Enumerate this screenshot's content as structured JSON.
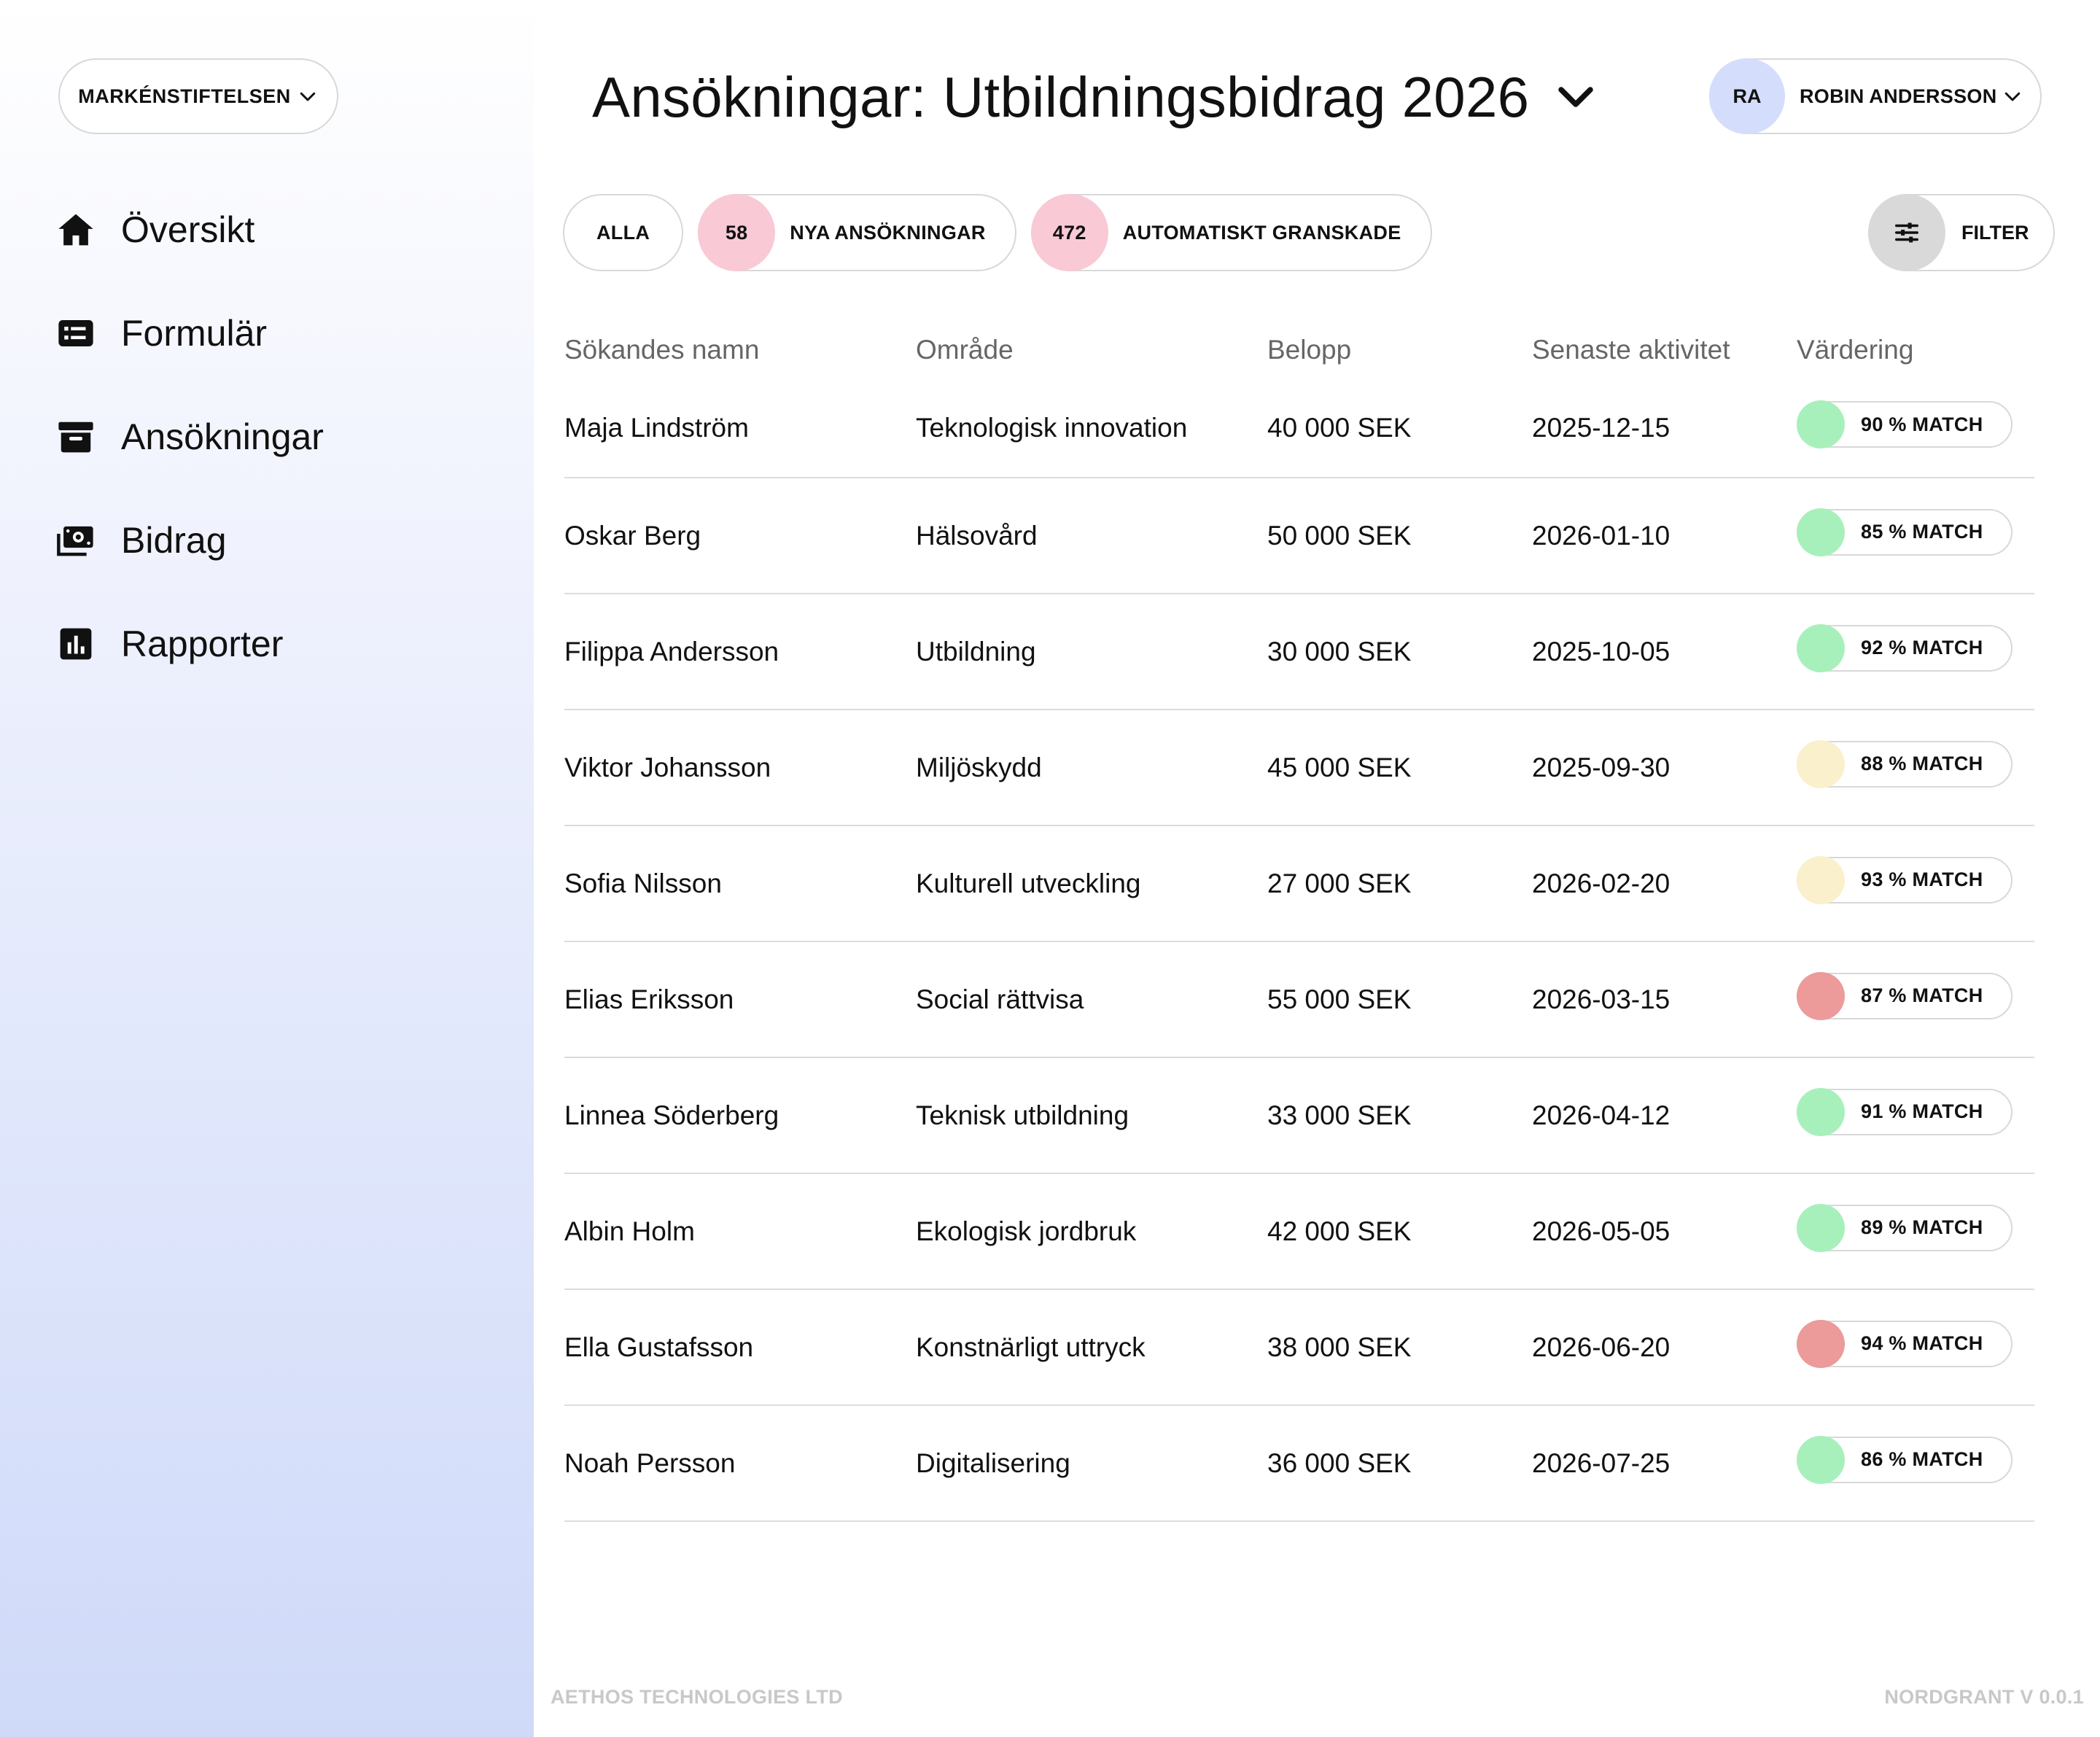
{
  "org": {
    "name": "MARKÉNSTIFTELSEN"
  },
  "nav": [
    {
      "label": "Översikt",
      "icon": "home-icon"
    },
    {
      "label": "Formulär",
      "icon": "form-list-icon"
    },
    {
      "label": "Ansökningar",
      "icon": "archive-icon"
    },
    {
      "label": "Bidrag",
      "icon": "money-icon"
    },
    {
      "label": "Rapporter",
      "icon": "report-chart-icon"
    }
  ],
  "header": {
    "title": "Ansökningar: Utbildningsbidrag 2026"
  },
  "user": {
    "initials": "RA",
    "name": "ROBIN ANDERSSON"
  },
  "tabs": {
    "all": "ALLA",
    "new": {
      "count": "58",
      "label": "NYA ANSÖKNINGAR"
    },
    "auto": {
      "count": "472",
      "label": "AUTOMATISKT GRANSKADE"
    }
  },
  "filter": {
    "label": "FILTER",
    "icon": "sliders-icon"
  },
  "table": {
    "columns": [
      "Sökandes namn",
      "Område",
      "Belopp",
      "Senaste aktivitet",
      "Värdering"
    ],
    "rows": [
      {
        "name": "Maja Lindström",
        "area": "Teknologisk innovation",
        "amount": "40 000 SEK",
        "date": "2025-12-15",
        "match": "90 % MATCH",
        "status_color": "#a8f0bb"
      },
      {
        "name": "Oskar Berg",
        "area": "Hälsovård",
        "amount": "50 000 SEK",
        "date": "2026-01-10",
        "match": "85 % MATCH",
        "status_color": "#a8f0bb"
      },
      {
        "name": "Filippa Andersson",
        "area": "Utbildning",
        "amount": "30 000 SEK",
        "date": "2025-10-05",
        "match": "92 % MATCH",
        "status_color": "#a8f0bb"
      },
      {
        "name": "Viktor Johansson",
        "area": "Miljöskydd",
        "amount": "45 000 SEK",
        "date": "2025-09-30",
        "match": "88 % MATCH",
        "status_color": "#faf0cc"
      },
      {
        "name": "Sofia Nilsson",
        "area": "Kulturell utveckling",
        "amount": "27 000 SEK",
        "date": "2026-02-20",
        "match": "93 % MATCH",
        "status_color": "#faf0cc"
      },
      {
        "name": "Elias Eriksson",
        "area": "Social rättvisa",
        "amount": "55 000 SEK",
        "date": "2026-03-15",
        "match": "87 % MATCH",
        "status_color": "#ec9a9a"
      },
      {
        "name": "Linnea Söderberg",
        "area": "Teknisk utbildning",
        "amount": "33 000 SEK",
        "date": "2026-04-12",
        "match": "91 % MATCH",
        "status_color": "#a8f0bb"
      },
      {
        "name": "Albin Holm",
        "area": "Ekologisk jordbruk",
        "amount": "42 000 SEK",
        "date": "2026-05-05",
        "match": "89 % MATCH",
        "status_color": "#a8f0bb"
      },
      {
        "name": "Ella Gustafsson",
        "area": "Konstnärligt uttryck",
        "amount": "38 000 SEK",
        "date": "2026-06-20",
        "match": "94 % MATCH",
        "status_color": "#ec9a9a"
      },
      {
        "name": "Noah Persson",
        "area": "Digitalisering",
        "amount": "36 000 SEK",
        "date": "2026-07-25",
        "match": "86 % MATCH",
        "status_color": "#a8f0bb"
      }
    ]
  },
  "footer": {
    "company": "AETHOS TECHNOLOGIES LTD",
    "version": "NORDGRANT V 0.0.1"
  }
}
